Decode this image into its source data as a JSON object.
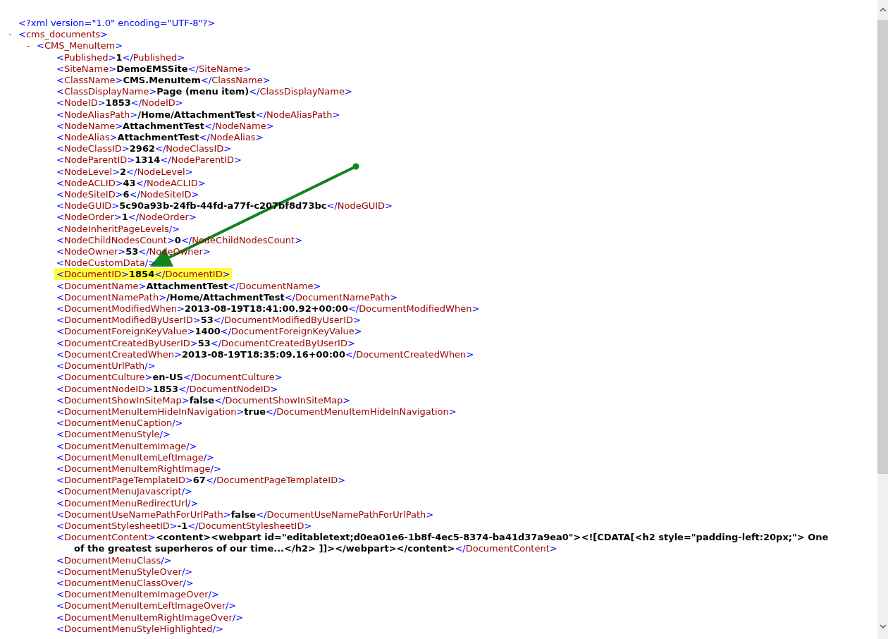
{
  "declaration": "<?xml version=\"1.0\" encoding=\"UTF-8\"?>",
  "root": {
    "toggle": "-",
    "tag": "<cms_documents>",
    "expanded": true,
    "child": {
      "toggle": "-",
      "tag": "<CMS_MenuItem>",
      "expanded": true,
      "elements": [
        {
          "open": "<Published>",
          "value": "1",
          "close": "</Published>",
          "highlighted": false
        },
        {
          "open": "<SiteName>",
          "value": "DemoEMSSite",
          "close": "</SiteName>",
          "highlighted": false
        },
        {
          "open": "<ClassName>",
          "value": "CMS.MenuItem",
          "close": "</ClassName>",
          "highlighted": false
        },
        {
          "open": "<ClassDisplayName>",
          "value": "Page (menu item)",
          "close": "</ClassDisplayName>",
          "highlighted": false
        },
        {
          "open": "<NodeID>",
          "value": "1853",
          "close": "</NodeID>",
          "highlighted": false
        },
        {
          "open": "<NodeAliasPath>",
          "value": "/Home/AttachmentTest",
          "close": "</NodeAliasPath>",
          "highlighted": false
        },
        {
          "open": "<NodeName>",
          "value": "AttachmentTest",
          "close": "</NodeName>",
          "highlighted": false
        },
        {
          "open": "<NodeAlias>",
          "value": "AttachmentTest",
          "close": "</NodeAlias>",
          "highlighted": false
        },
        {
          "open": "<NodeClassID>",
          "value": "2962",
          "close": "</NodeClassID>",
          "highlighted": false
        },
        {
          "open": "<NodeParentID>",
          "value": "1314",
          "close": "</NodeParentID>",
          "highlighted": false
        },
        {
          "open": "<NodeLevel>",
          "value": "2",
          "close": "</NodeLevel>",
          "highlighted": false
        },
        {
          "open": "<NodeACLID>",
          "value": "43",
          "close": "</NodeACLID>",
          "highlighted": false
        },
        {
          "open": "<NodeSiteID>",
          "value": "6",
          "close": "</NodeSiteID>",
          "highlighted": false
        },
        {
          "open": "<NodeGUID>",
          "value": "5c90a93b-24fb-44fd-a77f-c207bf8d73bc",
          "close": "</NodeGUID>",
          "highlighted": false
        },
        {
          "open": "<NodeOrder>",
          "value": "1",
          "close": "</NodeOrder>",
          "highlighted": false
        },
        {
          "open": "<NodeInheritPageLevels/>",
          "highlighted": false
        },
        {
          "open": "<NodeChildNodesCount>",
          "value": "0",
          "close": "</NodeChildNodesCount>",
          "highlighted": false
        },
        {
          "open": "<NodeOwner>",
          "value": "53",
          "close": "</NodeOwner>",
          "highlighted": false
        },
        {
          "open": "<NodeCustomData/>",
          "highlighted": false
        },
        {
          "open": "<DocumentID>",
          "value": "1854",
          "close": "</DocumentID>",
          "highlighted": true
        },
        {
          "open": "<DocumentName>",
          "value": "AttachmentTest",
          "close": "</DocumentName>",
          "highlighted": false
        },
        {
          "open": "<DocumentNamePath>",
          "value": "/Home/AttachmentTest",
          "close": "</DocumentNamePath>",
          "highlighted": false
        },
        {
          "open": "<DocumentModifiedWhen>",
          "value": "2013-08-19T18:41:00.92+00:00",
          "close": "</DocumentModifiedWhen>",
          "highlighted": false
        },
        {
          "open": "<DocumentModifiedByUserID>",
          "value": "53",
          "close": "</DocumentModifiedByUserID>",
          "highlighted": false
        },
        {
          "open": "<DocumentForeignKeyValue>",
          "value": "1400",
          "close": "</DocumentForeignKeyValue>",
          "highlighted": false
        },
        {
          "open": "<DocumentCreatedByUserID>",
          "value": "53",
          "close": "</DocumentCreatedByUserID>",
          "highlighted": false
        },
        {
          "open": "<DocumentCreatedWhen>",
          "value": "2013-08-19T18:35:09.16+00:00",
          "close": "</DocumentCreatedWhen>",
          "highlighted": false
        },
        {
          "open": "<DocumentUrlPath/>",
          "highlighted": false
        },
        {
          "open": "<DocumentCulture>",
          "value": "en-US",
          "close": "</DocumentCulture>",
          "highlighted": false
        },
        {
          "open": "<DocumentNodeID>",
          "value": "1853",
          "close": "</DocumentNodeID>",
          "highlighted": false
        },
        {
          "open": "<DocumentShowInSiteMap>",
          "value": "false",
          "close": "</DocumentShowInSiteMap>",
          "highlighted": false
        },
        {
          "open": "<DocumentMenuItemHideInNavigation>",
          "value": "true",
          "close": "</DocumentMenuItemHideInNavigation>",
          "highlighted": false
        },
        {
          "open": "<DocumentMenuCaption/>",
          "highlighted": false
        },
        {
          "open": "<DocumentMenuStyle/>",
          "highlighted": false
        },
        {
          "open": "<DocumentMenuItemImage/>",
          "highlighted": false
        },
        {
          "open": "<DocumentMenuItemLeftImage/>",
          "highlighted": false
        },
        {
          "open": "<DocumentMenuItemRightImage/>",
          "highlighted": false
        },
        {
          "open": "<DocumentPageTemplateID>",
          "value": "67",
          "close": "</DocumentPageTemplateID>",
          "highlighted": false
        },
        {
          "open": "<DocumentMenuJavascript/>",
          "highlighted": false
        },
        {
          "open": "<DocumentMenuRedirectUrl/>",
          "highlighted": false
        },
        {
          "open": "<DocumentUseNamePathForUrlPath>",
          "value": "false",
          "close": "</DocumentUseNamePathForUrlPath>",
          "highlighted": false
        },
        {
          "open": "<DocumentStylesheetID>",
          "value": "-1",
          "close": "</DocumentStylesheetID>",
          "highlighted": false
        },
        {
          "open": "<DocumentContent>",
          "value": [
            "<content><webpart id=\"editabletext;d0ea01e6-1b8f-4ec5-8374-ba41d37a9ea0\"><![CDATA[<h2 style=\"padding-left:20px;\"> One",
            "of the greatest superheros of our time...</h2> ]]></webpart></content>"
          ],
          "close": "</DocumentContent>",
          "highlighted": false
        },
        {
          "open": "<DocumentMenuClass/>",
          "highlighted": false
        },
        {
          "open": "<DocumentMenuStyleOver/>",
          "highlighted": false
        },
        {
          "open": "<DocumentMenuClassOver/>",
          "highlighted": false
        },
        {
          "open": "<DocumentMenuItemImageOver/>",
          "highlighted": false
        },
        {
          "open": "<DocumentMenuItemLeftImageOver/>",
          "highlighted": false
        },
        {
          "open": "<DocumentMenuItemRightImageOver/>",
          "highlighted": false
        },
        {
          "open": "<DocumentMenuStyleHighlighted/>",
          "highlighted": false
        }
      ]
    }
  }
}
